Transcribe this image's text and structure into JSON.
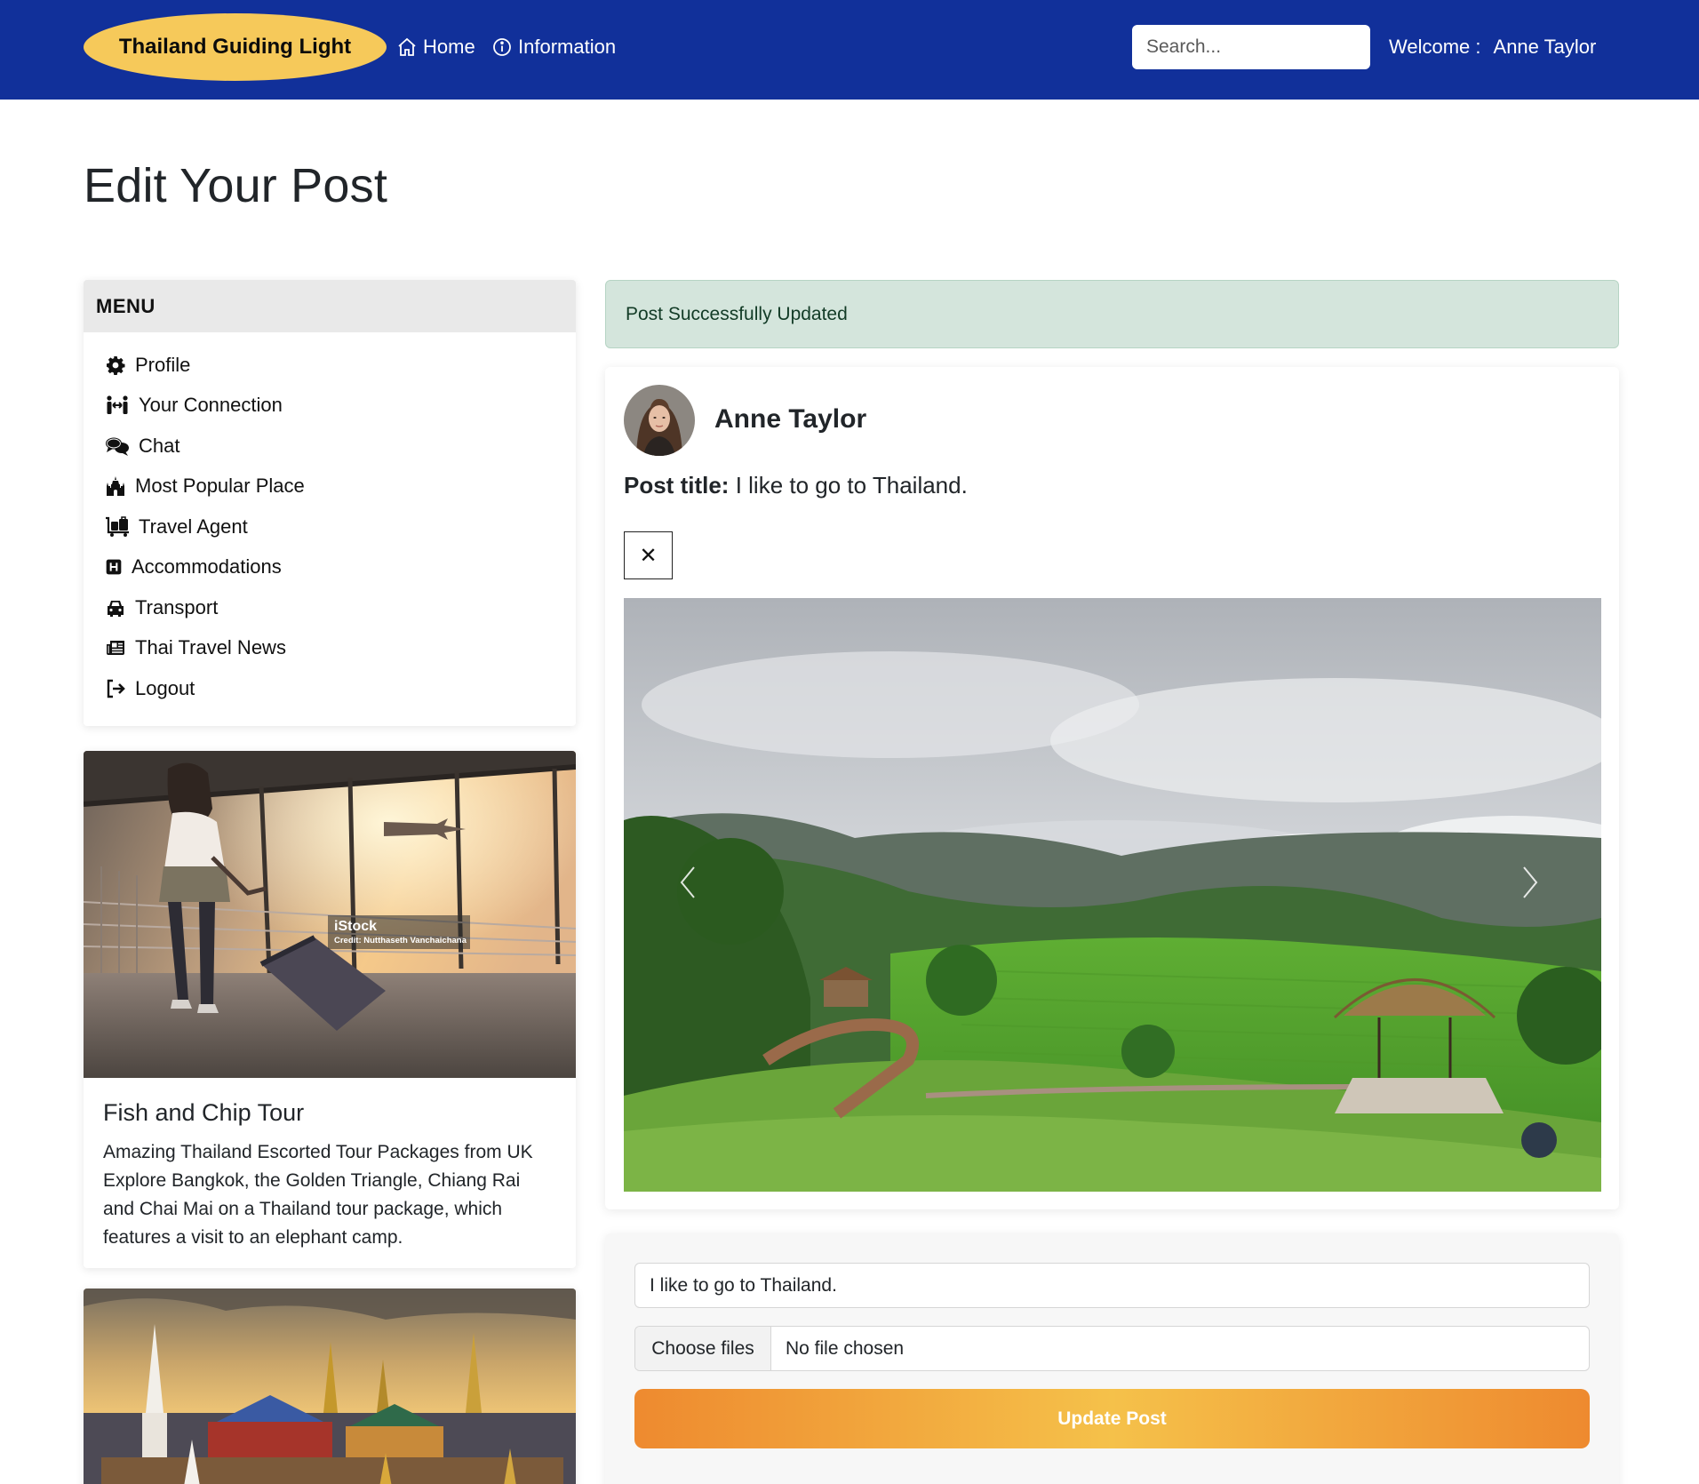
{
  "navbar": {
    "brand": "Thailand Guiding Light",
    "home_label": "Home",
    "info_label": "Information",
    "search_placeholder": "Search...",
    "welcome_label": "Welcome :",
    "user_name": "Anne Taylor",
    "colors": {
      "navbar_bg": "#11309a",
      "brand_bg": "#f6c95a"
    }
  },
  "page": {
    "title": "Edit Your Post"
  },
  "sidebar": {
    "menu_title": "MENU",
    "items": [
      {
        "label": "Profile",
        "icon": "gear-icon"
      },
      {
        "label": "Your Connection",
        "icon": "people-arrows-icon"
      },
      {
        "label": "Chat",
        "icon": "comments-icon"
      },
      {
        "label": "Most Popular Place",
        "icon": "landmark-icon"
      },
      {
        "label": "Travel Agent",
        "icon": "luggage-cart-icon"
      },
      {
        "label": "Accommodations",
        "icon": "hotel-icon"
      },
      {
        "label": "Transport",
        "icon": "car-icon"
      },
      {
        "label": "Thai Travel News",
        "icon": "newspaper-icon"
      },
      {
        "label": "Logout",
        "icon": "logout-icon"
      }
    ],
    "cards": [
      {
        "title": "Fish and Chip Tour",
        "text": "Amazing Thailand Escorted Tour Packages from UK Explore Bangkok, the Golden Triangle, Chiang Rai and Chai Mai on a Thailand tour package, which features a visit to an elephant camp.",
        "image_watermark": "iStock",
        "image_credit": "Credit: Nutthaseth Vanchaichana"
      },
      {
        "image": "temple-skyline"
      }
    ]
  },
  "alert": {
    "message": "Post Successfully Updated",
    "color": "#d4e5dc"
  },
  "post": {
    "author": "Anne Taylor",
    "title_label": "Post title:",
    "title_value": "I like to go to Thailand.",
    "close_symbol": "✕"
  },
  "form": {
    "title_value": "I like to go to Thailand.",
    "file_button": "Choose files",
    "file_status": "No file chosen",
    "submit_label": "Update Post"
  }
}
